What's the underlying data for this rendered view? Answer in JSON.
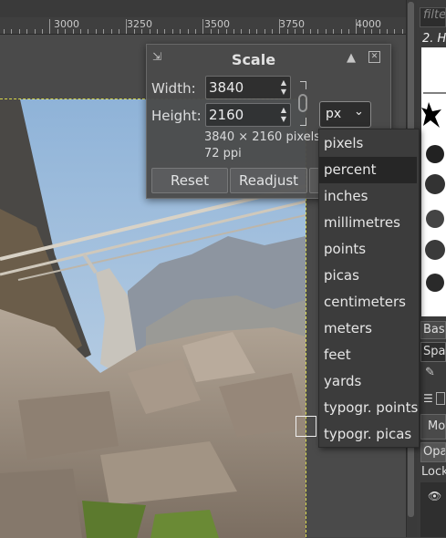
{
  "ruler": {
    "labels": [
      "3000",
      "3250",
      "3500",
      "3750",
      "4000"
    ]
  },
  "dialog": {
    "title": "Scale",
    "width_label": "Width:",
    "width_value": "3840",
    "height_label": "Height:",
    "height_value": "2160",
    "size_info": "3840 × 2160 pixels",
    "resolution_info": "72 ppi",
    "reset_label": "Reset",
    "readjust_label": "Readjust"
  },
  "unit_combo": {
    "selected": "px"
  },
  "unit_menu": {
    "items": [
      "pixels",
      "percent",
      "inches",
      "millimetres",
      "points",
      "picas",
      "centimeters",
      "meters",
      "feet",
      "yards",
      "typogr. points",
      "typogr. picas"
    ],
    "highlighted": "percent"
  },
  "dock": {
    "filter_placeholder": "filte",
    "brush_name": "2. H",
    "tag_label": "Basi",
    "spacing_label": "Spac",
    "mode_label": "Mo",
    "opacity_label": "Opa",
    "lock_label": "Lock"
  },
  "colors": {
    "selection_guide": "#d8d84a",
    "menu_highlight": "#262626",
    "dialog_bg": "#4b4b4b"
  }
}
